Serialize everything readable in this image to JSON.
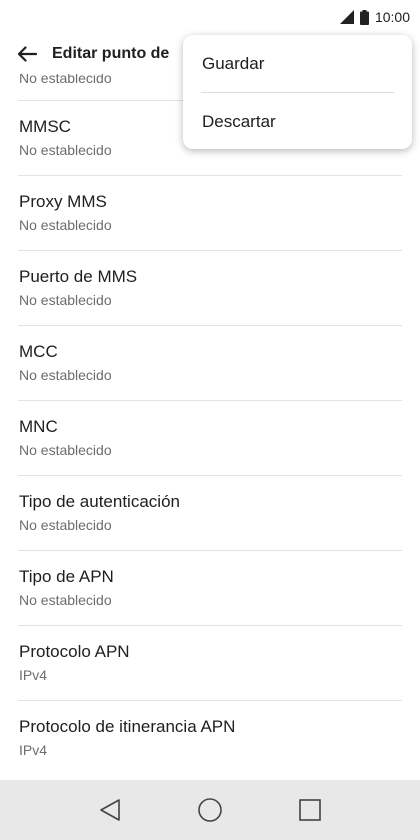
{
  "status_bar": {
    "time": "10:00"
  },
  "app_bar": {
    "title": "Editar punto de"
  },
  "partial_row": {
    "subtitle": "No establecido"
  },
  "settings": [
    {
      "title": "MMSC",
      "value": "No establecido"
    },
    {
      "title": "Proxy MMS",
      "value": "No establecido"
    },
    {
      "title": "Puerto de MMS",
      "value": "No establecido"
    },
    {
      "title": "MCC",
      "value": "No establecido"
    },
    {
      "title": "MNC",
      "value": "No establecido"
    },
    {
      "title": "Tipo de autenticación",
      "value": "No establecido"
    },
    {
      "title": "Tipo de APN",
      "value": "No establecido"
    },
    {
      "title": "Protocolo APN",
      "value": "IPv4"
    },
    {
      "title": "Protocolo de itinerancia APN",
      "value": "IPv4"
    }
  ],
  "menu": {
    "save_label": "Guardar",
    "discard_label": "Descartar"
  }
}
